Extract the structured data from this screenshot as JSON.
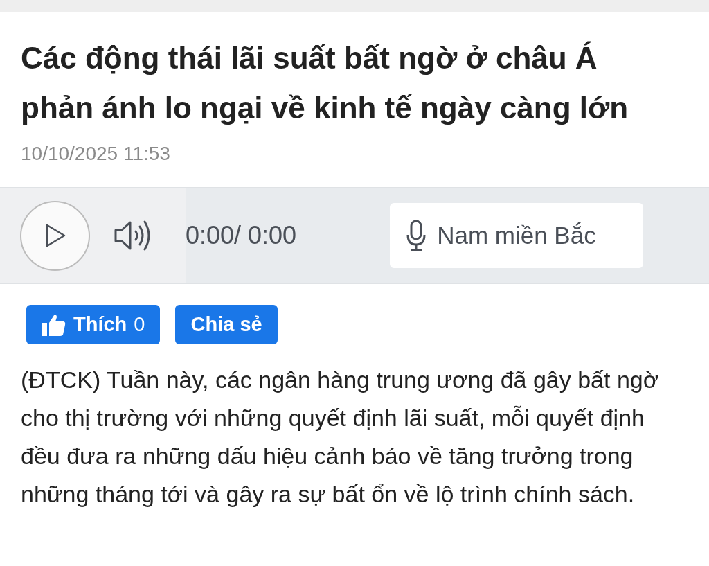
{
  "article": {
    "title": "Các động thái lãi suất bất ngờ ở châu Á phản ánh lo ngại về kinh tế ngày càng lớn",
    "date": "10/10/2025 11:53"
  },
  "player": {
    "time": "0:00/ 0:00",
    "voice": "Nam miền Bắc"
  },
  "actions": {
    "like_label": "Thích",
    "like_count": "0",
    "share_label": "Chia sẻ"
  },
  "body": "(ĐTCK) Tuần này, các ngân hàng trung ương đã gây bất ngờ cho thị trường với những quyết định lãi suất, mỗi quyết định đều đưa ra những dấu hiệu cảnh báo về tăng trưởng trong những tháng tới và gây ra sự bất ổn về lộ trình chính sách."
}
